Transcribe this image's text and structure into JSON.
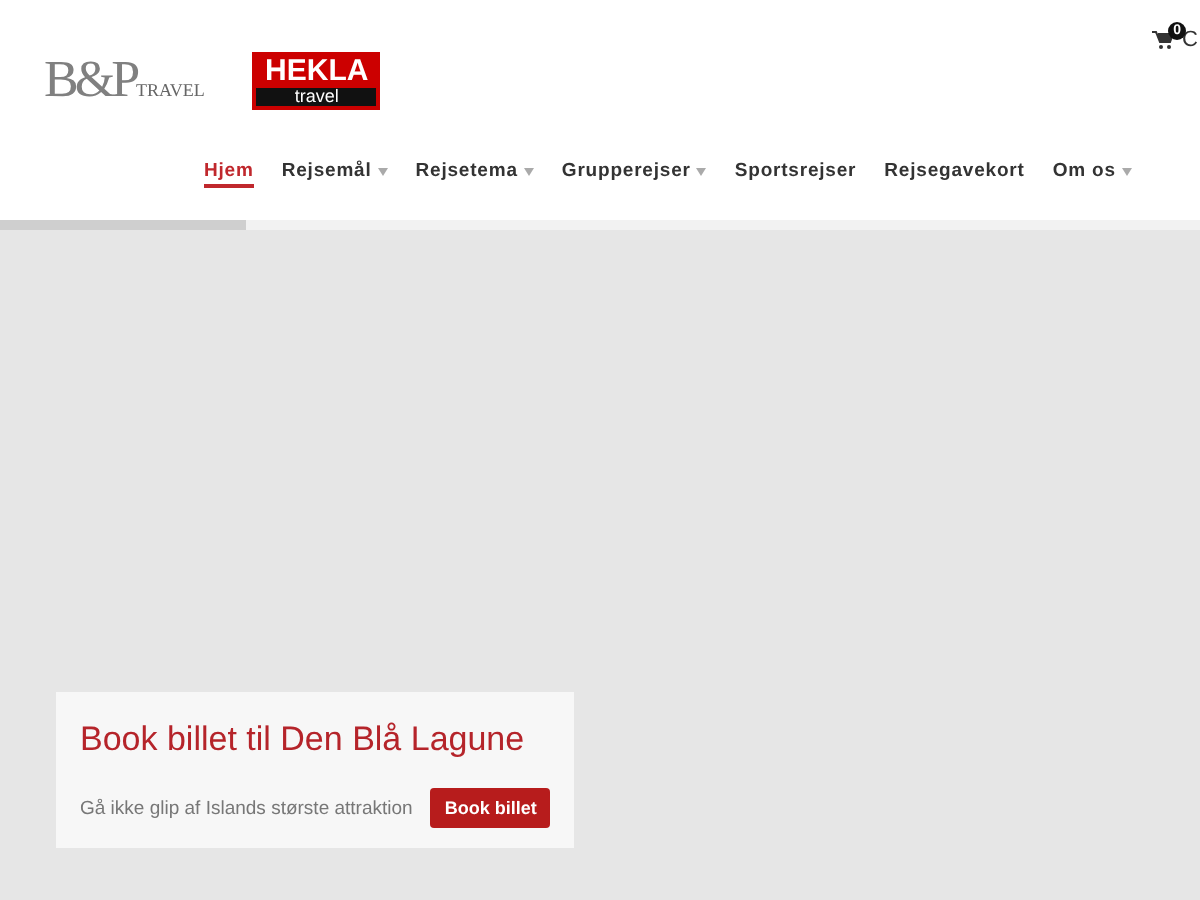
{
  "logos": [
    {
      "kind": "bp",
      "main": "B&P",
      "sub": "TRAVEL"
    },
    {
      "kind": "hekla",
      "main": "HEKLA",
      "sub": "travel"
    }
  ],
  "cart": {
    "count": "0",
    "label": "C"
  },
  "nav": [
    {
      "label": "Hjem",
      "selected": true,
      "dropdown": false
    },
    {
      "label": "Rejsemål",
      "selected": false,
      "dropdown": true
    },
    {
      "label": "Rejsetema",
      "selected": false,
      "dropdown": true
    },
    {
      "label": "Grupperejser",
      "selected": false,
      "dropdown": true
    },
    {
      "label": "Sportsrejser",
      "selected": false,
      "dropdown": false
    },
    {
      "label": "Rejsegavekort",
      "selected": false,
      "dropdown": false
    },
    {
      "label": "Om os",
      "selected": false,
      "dropdown": true
    }
  ],
  "loading": {
    "level": 0.205
  },
  "promo": {
    "title": "Book billet til Den Blå Lagune",
    "text": "Gå ikke glip af Islands største attraktion",
    "button": "Book billet"
  }
}
